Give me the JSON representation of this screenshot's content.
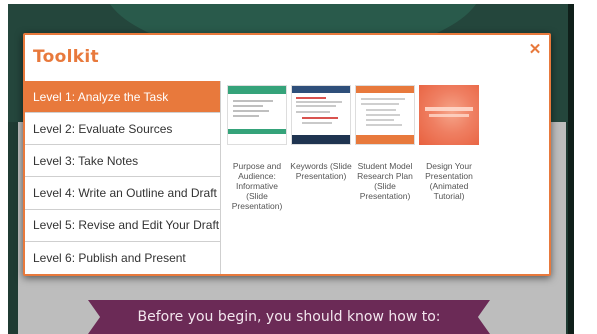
{
  "background": {
    "banner_text": "Before you begin, you should know how to:"
  },
  "modal": {
    "title": "Toolkit",
    "close_icon": "close-icon",
    "accent_color": "#e8793c"
  },
  "levels": [
    {
      "label": "Level 1: Analyze the Task",
      "active": true
    },
    {
      "label": "Level 2: Evaluate Sources",
      "active": false
    },
    {
      "label": "Level 3: Take Notes",
      "active": false
    },
    {
      "label": "Level 4: Write an Outline and Draft",
      "active": false
    },
    {
      "label": "Level 5: Revise and Edit Your Draft",
      "active": false
    },
    {
      "label": "Level 6: Publish and Present",
      "active": false
    }
  ],
  "resources": [
    {
      "label": "Purpose and Audience: Informative (Slide Presentation)"
    },
    {
      "label": "Keywords (Slide Presentation)"
    },
    {
      "label": "Student Model Research Plan (Slide Presentation)"
    },
    {
      "label": "Design Your Presentation (Animated Tutorial)"
    }
  ]
}
